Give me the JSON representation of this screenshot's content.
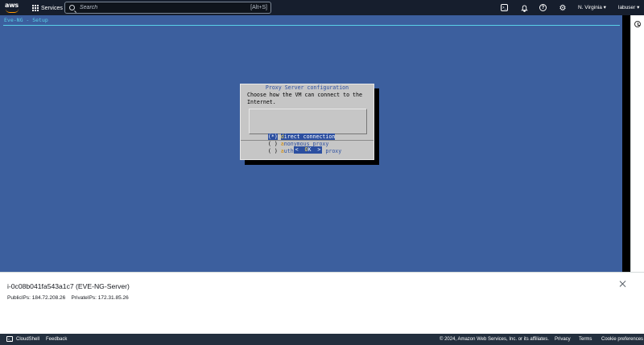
{
  "topnav": {
    "logo_text": "aws",
    "services_label": "Services",
    "search_placeholder": "Search",
    "search_shortcut": "[Alt+S]",
    "region": "N. Virginia ▾",
    "user": "labuser ▾"
  },
  "terminal": {
    "title": "Eve-NG - Setup",
    "dialog": {
      "title": "Proxy Server configuration",
      "text": "Choose how the VM can connect to the\nInternet.",
      "options": [
        {
          "radio": "(*)",
          "hot": "d",
          "rest": "irect connection",
          "selected": true
        },
        {
          "radio": "( )",
          "hot": "a",
          "rest": "nonymous proxy",
          "selected": false
        },
        {
          "radio": "( )",
          "hot": "a",
          "rest": "uthenticated proxy",
          "selected": false
        }
      ],
      "ok_left": "<  ",
      "ok_hot": "O",
      "ok_right": "K  >"
    }
  },
  "instance": {
    "title": "i-0c08b041fa543a1c7 (EVE-NG-Server)",
    "public_label": "PublicIPs:",
    "public_ip": "184.72.208.26",
    "private_label": "PrivateIPs:",
    "private_ip": "172.31.85.26"
  },
  "footer": {
    "cloudshell": "CloudShell",
    "feedback": "Feedback",
    "copyright": "© 2024, Amazon Web Services, Inc. or its affiliates.",
    "privacy": "Privacy",
    "terms": "Terms",
    "cookie": "Cookie preferences"
  },
  "colors": {
    "terminal_bg": "#3c5f9e",
    "dialog_bg": "#c6c6c6",
    "nav_bg": "#161e2d",
    "footer_bg": "#232f3e"
  },
  "icons": [
    "aws-logo",
    "grid-icon",
    "search-icon",
    "cloudshell-icon",
    "bell-icon",
    "help-icon",
    "gear-icon",
    "close-icon",
    "info-icon"
  ]
}
